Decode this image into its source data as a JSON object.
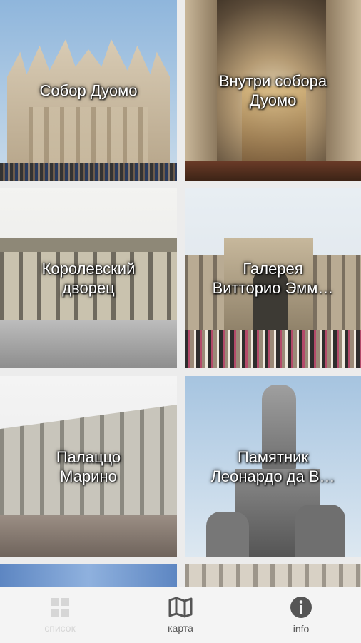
{
  "tiles": [
    {
      "title": "Собор Дуомо"
    },
    {
      "title": "Внутри собора\nДуомо"
    },
    {
      "title": "Королевский\nдворец"
    },
    {
      "title": "Галерея\nВитторио Эмм…"
    },
    {
      "title": "Палаццо\nМарино"
    },
    {
      "title": "Памятник\nЛеонардо да В…"
    }
  ],
  "nav": {
    "items": [
      {
        "label": "список",
        "icon": "grid-list-icon"
      },
      {
        "label": "карта",
        "icon": "map-icon"
      },
      {
        "label": "info",
        "icon": "info-icon"
      }
    ]
  }
}
